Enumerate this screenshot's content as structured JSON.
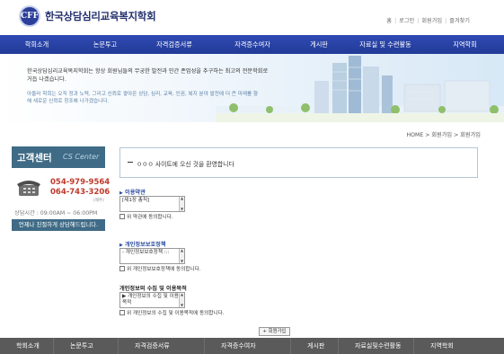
{
  "header": {
    "logo_text": "CFF",
    "title": "한국상담심리교육복지학회",
    "util_links": [
      "홈",
      "로그인",
      "회원가입",
      "즐겨찾기"
    ]
  },
  "topnav": [
    "학회소개",
    "논문투고",
    "자격검증서류",
    "자격증수여자",
    "게시판",
    "자료실 및 수련활동",
    "지역학회"
  ],
  "banner": {
    "line1": "한국상담심리교육복지학회는 항상 회원님들의 무궁한 발전과 인간 존엄성을 추구하는 최고의 전문학회로 거듭 나겠습니다.",
    "line2": "아울러 학회는 오직 정과 노력, 그리고 신뢰로 쌓아온 상담, 심리, 교육, 인권, 복지 분야 발전에 더 큰 미래를 향해 새로운 신뢰로 창조해 나가겠습니다."
  },
  "breadcrumb": "HOME > 회원가입 > 회원가입",
  "sidebar": {
    "cs_title_ko": "고객센터",
    "cs_title_en": "CS Center",
    "phone1": "054-979-9564",
    "phone2": "064-743-3206",
    "phone_note": "(제주)",
    "hours": "상담시간 : 09:00AM ~ 06:00PM",
    "consult_button": "언제나 친절하게 상담해드립니다."
  },
  "main": {
    "welcome_text": "ㅇㅇㅇ 사이트에 오신 것을 환영합니다",
    "sections": [
      {
        "title": "이용약관",
        "box_text": "[제1장 총칙]",
        "agree_label": "위 약관에 동의합니다."
      },
      {
        "title": "개인정보보호정책",
        "box_text": "- 개인정보보호정책 :::",
        "agree_label": "위 개인정보보호정책에 동의합니다."
      },
      {
        "title": "개인정보의 수집 및 이용목적",
        "box_text": "▶ 개인정보의 수집 및 이용목적",
        "agree_label": "위 개인정보의 수집 및 이용목적에 동의합니다."
      }
    ],
    "join_button": "+ 회원가입"
  },
  "footer_nav": [
    "학회소개",
    "논문투고",
    "자격검증서류",
    "자격증수여자",
    "게시판",
    "자료실및수련활동",
    "지역학회"
  ],
  "colors": {
    "nav_blue": "#223b97",
    "cs_teal": "#3f6b86",
    "phone_red": "#c0392b",
    "footer_gray": "#5a5a5a"
  }
}
